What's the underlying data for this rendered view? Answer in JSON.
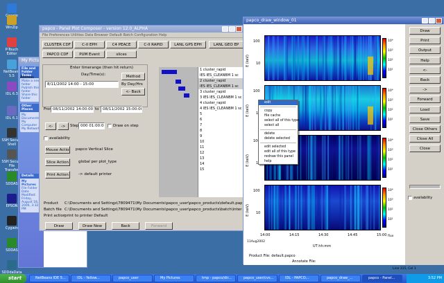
{
  "desktop_icons": [
    {
      "label": "Google Earth",
      "color": "#2f7ad8"
    },
    {
      "label": "WinZip",
      "color": "#c9a227"
    },
    {
      "label": "P-Touch Editor",
      "color": "#e04040"
    },
    {
      "label": "NetBeans 5.5",
      "color": "#4aa0d8"
    },
    {
      "label": "IDL 6.3",
      "color": "#8a4ac0"
    },
    {
      "label": "IDL 6.1",
      "color": "#6a6ac0"
    },
    {
      "label": "SSH Secure Shell",
      "color": "#333333"
    },
    {
      "label": "SSH Secure File Transfer",
      "color": "#555555"
    },
    {
      "label": "SDDAS",
      "color": "#2a8a2a"
    },
    {
      "label": "EPSON",
      "color": "#1c1c8a"
    },
    {
      "label": "Cygwin",
      "color": "#222222"
    },
    {
      "label": "SDDAS",
      "color": "#2a8a2a"
    },
    {
      "label": "SDDdaData",
      "color": "#2a6a8a"
    }
  ],
  "explorer": {
    "title": "My Pictures",
    "address_label": "Address",
    "tasks": {
      "header": "File and Folder Tasks",
      "items": [
        "Make a new folder",
        "Publish this folder",
        "Share this folder"
      ]
    },
    "other_places": {
      "header": "Other Places",
      "items": [
        "My Documents",
        "My Computer",
        "My Network"
      ]
    },
    "details": {
      "header": "Details",
      "name": "My Pictures",
      "type": "File Folder",
      "modified": "Date Modified: Friday, August 18, 2006, 3:32 PM"
    },
    "files": [
      "Pictures",
      "Order",
      "View"
    ]
  },
  "papco": {
    "title": "papco - Panel Plot Composer - version 12.0_ALPHA",
    "menu": "File   Preferences   Utilities   Data Browser   Default   Batch   Configuration   Help",
    "modules": [
      "CLUSTER CDF",
      "C-II EPH",
      "C4 PEACE",
      "C-II RAPID",
      "LANL GPS EPH",
      "LANL GEO EP",
      "PAPCO CDF",
      "PUM Event",
      "slices"
    ],
    "time_section_label": "Enter timerange (then hit return)",
    "day_prompt": "Day/Time(s):",
    "method_button": "Method",
    "day_field": "8/11/2002 14:00 - 15:00",
    "by_day_label": "By Day/Hrs",
    "back_button": "<- Back",
    "from_label": "From",
    "from_value": "08/11/2002 14:00:00",
    "to_label": "to",
    "to_value": "08/11/2002 15:00:00",
    "prev_button": "<-",
    "next_button": "->",
    "step_label": "Step",
    "step_value": "000 01:00:00",
    "draw_on_step_label": "Draw on step",
    "availability_label": "availability",
    "mouse_action_button": "Mouse Action",
    "mouse_action_value": "papco Vertical Slice",
    "slice_action_button": "Slice Action",
    "slice_action_value": "global per plot_type",
    "print_action_button": "Print Action",
    "print_action_value": "-> default printer",
    "entries": [
      "1  cluster_rapid",
      "IES IES_CLEANBM 1 sc",
      "2  cluster_rapid",
      "IES IES_CLEANBM 1 sc",
      "3  cluster_rapid",
      "3 IES IES_CLEANBM 1 sc",
      "4  cluster_rapid",
      "4 IES IES_CLEANBM 1 sc",
      "5",
      "6",
      "7",
      "8",
      "9",
      "10",
      "11",
      "12",
      "13",
      "14",
      "15"
    ],
    "product_label": "Product",
    "product_value": "C:\\Documents and Settings\\7809471\\My Documents\\papco_user\\papco_products\\default.papco (modified)",
    "batch_label": "Batch file",
    "batch_value": "C:\\Documents and Settings\\7809471\\My Documents\\papco_user\\papco_products\\batch\\interactive.papco_bat",
    "print_label": "Print action",
    "print_value": "print to printer Default",
    "bottom_buttons": [
      "Draw",
      "Draw New",
      "Back",
      "Forward"
    ]
  },
  "draw_window": {
    "title": "papco_draw_window_01",
    "buttons": [
      "Draw",
      "Print",
      "Output",
      "Help",
      "<-",
      "Back",
      "->",
      "Forward",
      "Load",
      "Save",
      "Close Others",
      "Close All",
      "Close"
    ],
    "availability_label": "availability",
    "panel_ylabels": [
      "E (keV)",
      "E (keV)",
      "E (keV)",
      "E (keV)"
    ],
    "yticks": [
      "100",
      "10",
      "100",
      "10",
      "100",
      "10",
      "100",
      "10"
    ],
    "x_ticks": [
      "14:00",
      "14:15",
      "14:30",
      "14:45",
      "15:00"
    ],
    "x_date": "11Aug2002",
    "x_unit": "UT hh:mm",
    "cbar_label": "flux",
    "product_footer": "Product File: default.papco",
    "annotate_footer": "Annotate File:",
    "cbar_ticks": [
      "10⁴",
      "10³",
      "10²",
      "10¹"
    ]
  },
  "context_menu": [
    "edit",
    "SEP",
    "copy",
    "file cache",
    "select all of this type",
    "select all",
    "SEP",
    "delete",
    "delete selected",
    "SEP",
    "edit selected",
    "edit all of this type",
    "redraw this panel",
    "help"
  ],
  "taskbar": {
    "start": "start",
    "tasks": [
      "NetBeans IDE 5...",
      "IDL - Yellow...",
      "papco_user",
      "My Pictures",
      "tmp - papco/dir...",
      "papco_user/cvs...",
      "IDL - PAPCO...",
      "papco_draw_...",
      "papco - Panel..."
    ],
    "clock": "3:52 PM"
  },
  "status_right": "Line 315, Col 1"
}
